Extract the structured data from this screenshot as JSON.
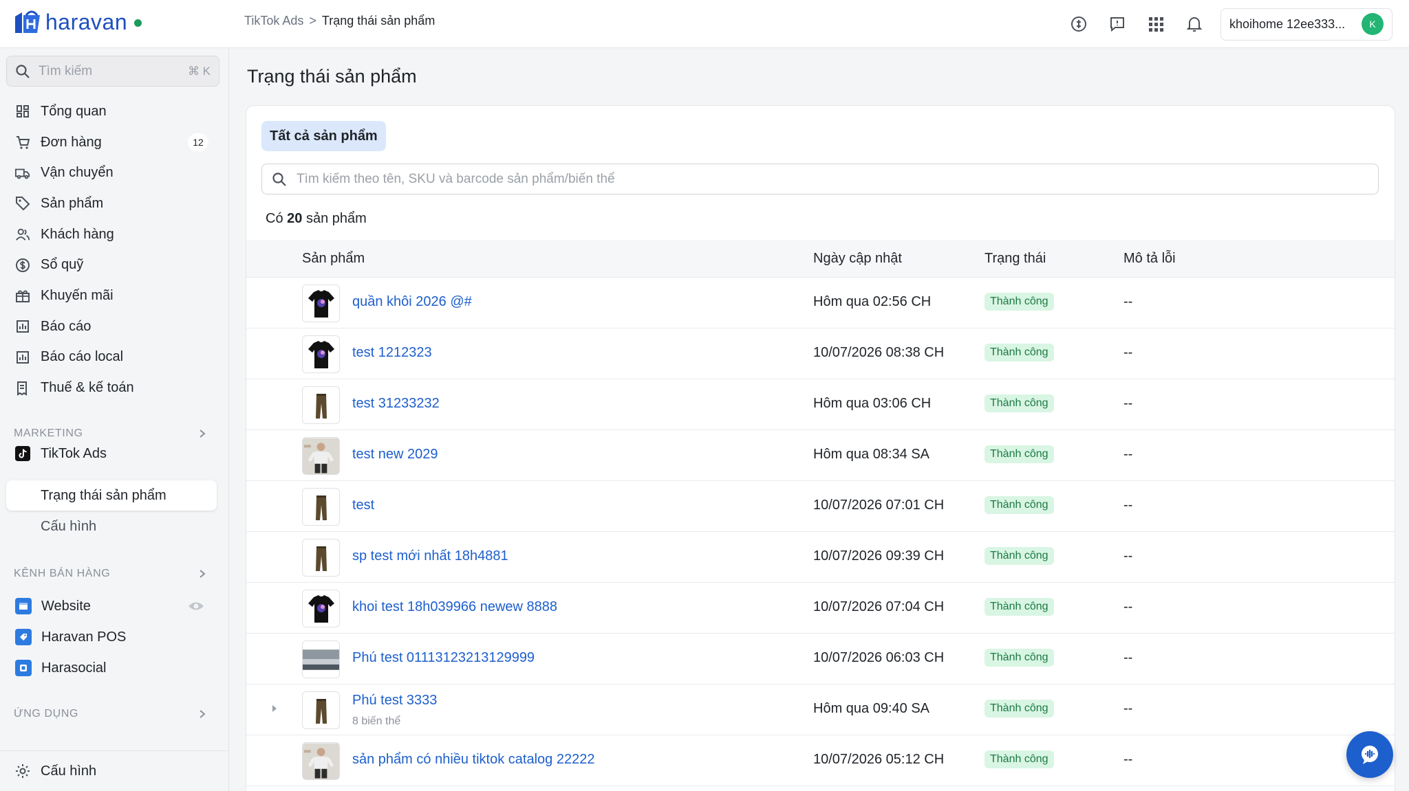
{
  "brand": {
    "name": "haravan"
  },
  "breadcrumb": {
    "parent": "TikTok Ads",
    "separator": ">",
    "current": "Trạng thái sản phẩm"
  },
  "account": {
    "name": "khoihome 12ee333...",
    "initial": "K"
  },
  "sidebar": {
    "search": {
      "placeholder": "Tìm kiếm",
      "shortcut": "⌘ K"
    },
    "items": [
      {
        "label": "Tổng quan",
        "icon": "dashboard-icon"
      },
      {
        "label": "Đơn hàng",
        "icon": "cart-icon",
        "badge": "12"
      },
      {
        "label": "Vận chuyển",
        "icon": "truck-icon"
      },
      {
        "label": "Sản phẩm",
        "icon": "tag-icon"
      },
      {
        "label": "Khách hàng",
        "icon": "users-icon"
      },
      {
        "label": "Sổ quỹ",
        "icon": "dollar-icon"
      },
      {
        "label": "Khuyến mãi",
        "icon": "gift-icon"
      },
      {
        "label": "Báo cáo",
        "icon": "chart-icon"
      },
      {
        "label": "Báo cáo local",
        "icon": "chart-icon"
      },
      {
        "label": "Thuế & kế toán",
        "icon": "receipt-icon"
      }
    ],
    "marketing": {
      "heading": "MARKETING",
      "app": "TikTok Ads",
      "sub": [
        "Trạng thái sản phẩm",
        "Cấu hình"
      ]
    },
    "channels": {
      "heading": "KÊNH BÁN HÀNG",
      "items": [
        "Website",
        "Haravan POS",
        "Harasocial"
      ]
    },
    "apps": {
      "heading": "ỨNG DỤNG"
    },
    "footer": {
      "label": "Cấu hình"
    }
  },
  "main": {
    "title": "Trạng thái sản phẩm",
    "tab": "Tất cả sản phẩm",
    "search_placeholder": "Tìm kiếm theo tên, SKU và barcode sản phẩm/biến thể",
    "count_prefix": "Có",
    "count_value": "20",
    "count_suffix": "sản phẩm",
    "columns": [
      "Sản phẩm",
      "Ngày cập nhật",
      "Trạng thái",
      "Mô tả lỗi"
    ],
    "rows": [
      {
        "name": "quần khôi 2026 @#",
        "date": "Hôm qua 02:56 CH",
        "status": "Thành công",
        "error": "--",
        "thumb": "tshirt"
      },
      {
        "name": "test 1212323",
        "date": "10/07/2026 08:38 CH",
        "status": "Thành công",
        "error": "--",
        "thumb": "tshirt"
      },
      {
        "name": "test 31233232",
        "date": "Hôm qua 03:06 CH",
        "status": "Thành công",
        "error": "--",
        "thumb": "pants"
      },
      {
        "name": "test new 2029",
        "date": "Hôm qua 08:34 SA",
        "status": "Thành công",
        "error": "--",
        "thumb": "person"
      },
      {
        "name": "test",
        "date": "10/07/2026 07:01 CH",
        "status": "Thành công",
        "error": "--",
        "thumb": "pants"
      },
      {
        "name": "sp test mới nhất 18h4881",
        "date": "10/07/2026 09:39 CH",
        "status": "Thành công",
        "error": "--",
        "thumb": "pants"
      },
      {
        "name": "khoi test 18h039966 newew 8888",
        "date": "10/07/2026 07:04 CH",
        "status": "Thành công",
        "error": "--",
        "thumb": "tshirt"
      },
      {
        "name": "Phú test 01113123213129999",
        "date": "10/07/2026 06:03 CH",
        "status": "Thành công",
        "error": "--",
        "thumb": "landscape"
      },
      {
        "name": "Phú test 3333",
        "sub": "8 biến thể",
        "date": "Hôm qua 09:40 SA",
        "status": "Thành công",
        "error": "--",
        "thumb": "pants"
      },
      {
        "name": "sản phẩm có nhiều tiktok catalog 22222",
        "date": "10/07/2026 05:12 CH",
        "status": "Thành công",
        "error": "--",
        "thumb": "person"
      }
    ]
  },
  "colors": {
    "accent": "#1d5fcc",
    "success_bg": "#d9f5e3",
    "success_text": "#1a7a43",
    "tab_bg": "#dbe8fb"
  }
}
